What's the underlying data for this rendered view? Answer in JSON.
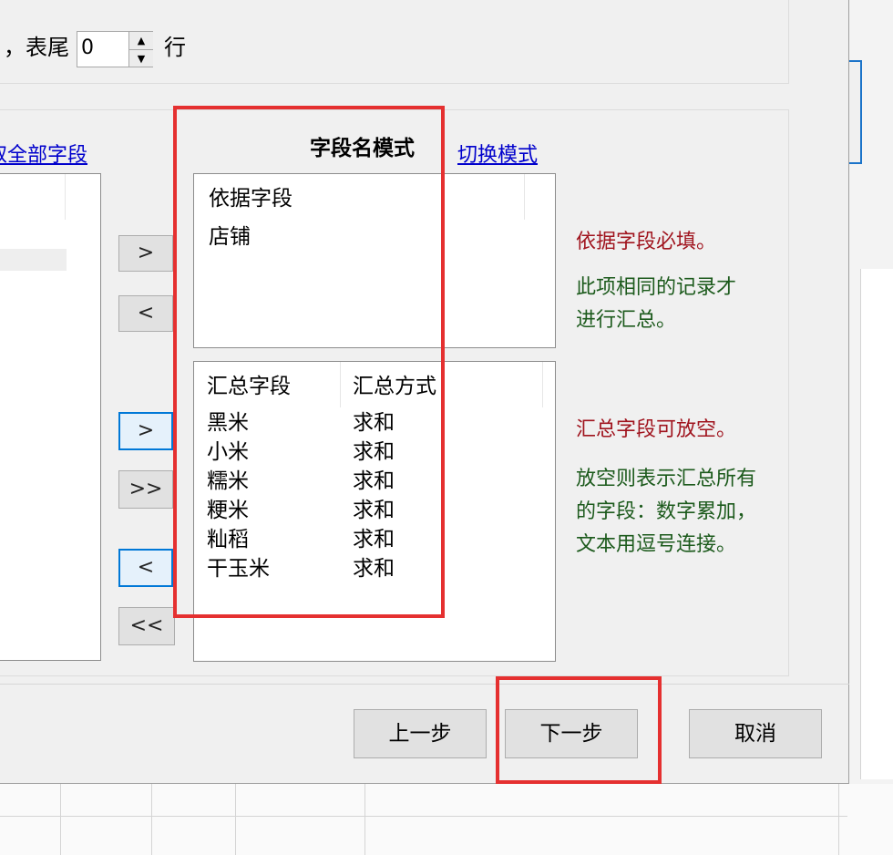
{
  "header": {
    "tail_prefix": "，表尾",
    "tail_value": "0",
    "tail_unit": "行"
  },
  "left": {
    "link_text": "取全部字段"
  },
  "mode": {
    "title": "字段名模式",
    "switch_link": "切换模式"
  },
  "basis": {
    "header": "依据字段",
    "items": [
      "店铺"
    ]
  },
  "summary": {
    "col_field": "汇总字段",
    "col_method": "汇总方式",
    "rows": [
      {
        "field": "黑米",
        "method": "求和"
      },
      {
        "field": "小米",
        "method": "求和"
      },
      {
        "field": "糯米",
        "method": "求和"
      },
      {
        "field": "粳米",
        "method": "求和"
      },
      {
        "field": "籼稻",
        "method": "求和"
      },
      {
        "field": "干玉米",
        "method": "求和"
      }
    ]
  },
  "arrows": {
    "right": ">",
    "left": "<",
    "all_right": ">>",
    "all_left": "<<"
  },
  "hints": {
    "basis_required": "依据字段必填。",
    "basis_desc_1": "此项相同的记录才",
    "basis_desc_2": "进行汇总。",
    "summary_optional": "汇总字段可放空。",
    "summary_desc_1": "放空则表示汇总所有",
    "summary_desc_2": "的字段：数字累加，",
    "summary_desc_3": "文本用逗号连接。"
  },
  "footer": {
    "prev": "上一步",
    "next": "下一步",
    "cancel": "取消"
  },
  "colors": {
    "highlight": "#e53030",
    "hint_red": "#a0141e",
    "hint_green": "#1c5a1c",
    "link": "#0000cc",
    "focus": "#0078d7"
  }
}
